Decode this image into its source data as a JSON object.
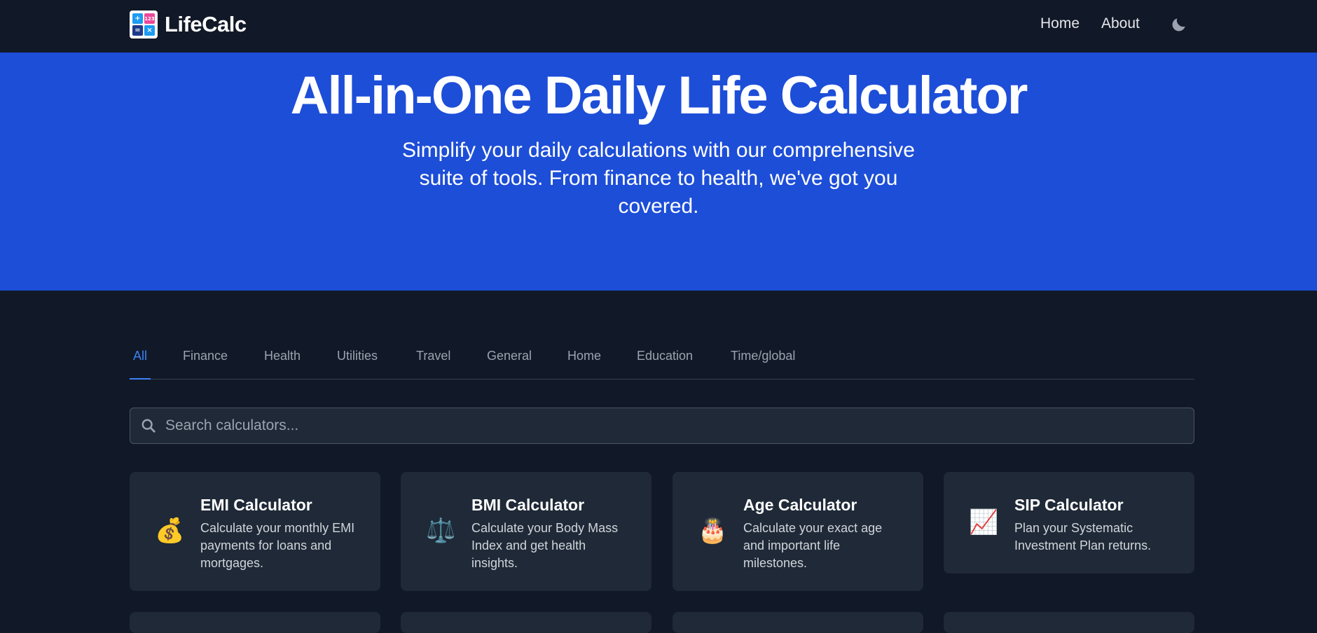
{
  "header": {
    "brand": "LifeCalc",
    "logo_glyphs": [
      "+",
      "123",
      "=",
      "×"
    ],
    "nav": [
      {
        "label": "Home"
      },
      {
        "label": "About"
      }
    ],
    "theme_icon": "moon-icon"
  },
  "hero": {
    "title": "All-in-One Daily Life Calculator",
    "subtitle": "Simplify your daily calculations with our comprehensive suite of tools. From finance to health, we've got you covered."
  },
  "tabs": [
    {
      "label": "All",
      "active": true
    },
    {
      "label": "Finance"
    },
    {
      "label": "Health"
    },
    {
      "label": "Utilities"
    },
    {
      "label": "Travel"
    },
    {
      "label": "General"
    },
    {
      "label": "Home"
    },
    {
      "label": "Education"
    },
    {
      "label": "Time/global"
    }
  ],
  "search": {
    "placeholder": "Search calculators...",
    "value": ""
  },
  "cards": [
    {
      "icon": "💰",
      "icon_name": "money-bag-icon",
      "title": "EMI Calculator",
      "desc": "Calculate your monthly EMI payments for loans and mortgages."
    },
    {
      "icon": "⚖️",
      "icon_name": "balance-scale-icon",
      "title": "BMI Calculator",
      "desc": "Calculate your Body Mass Index and get health insights."
    },
    {
      "icon": "🎂",
      "icon_name": "birthday-cake-icon",
      "title": "Age Calculator",
      "desc": "Calculate your exact age and important life milestones."
    },
    {
      "icon": "📈",
      "icon_name": "chart-increasing-icon",
      "title": "SIP Calculator",
      "desc": "Plan your Systematic Investment Plan returns."
    }
  ],
  "colors": {
    "background": "#111827",
    "hero": "#1d4ed8",
    "card": "#1f2937",
    "accent": "#3b82f6"
  }
}
